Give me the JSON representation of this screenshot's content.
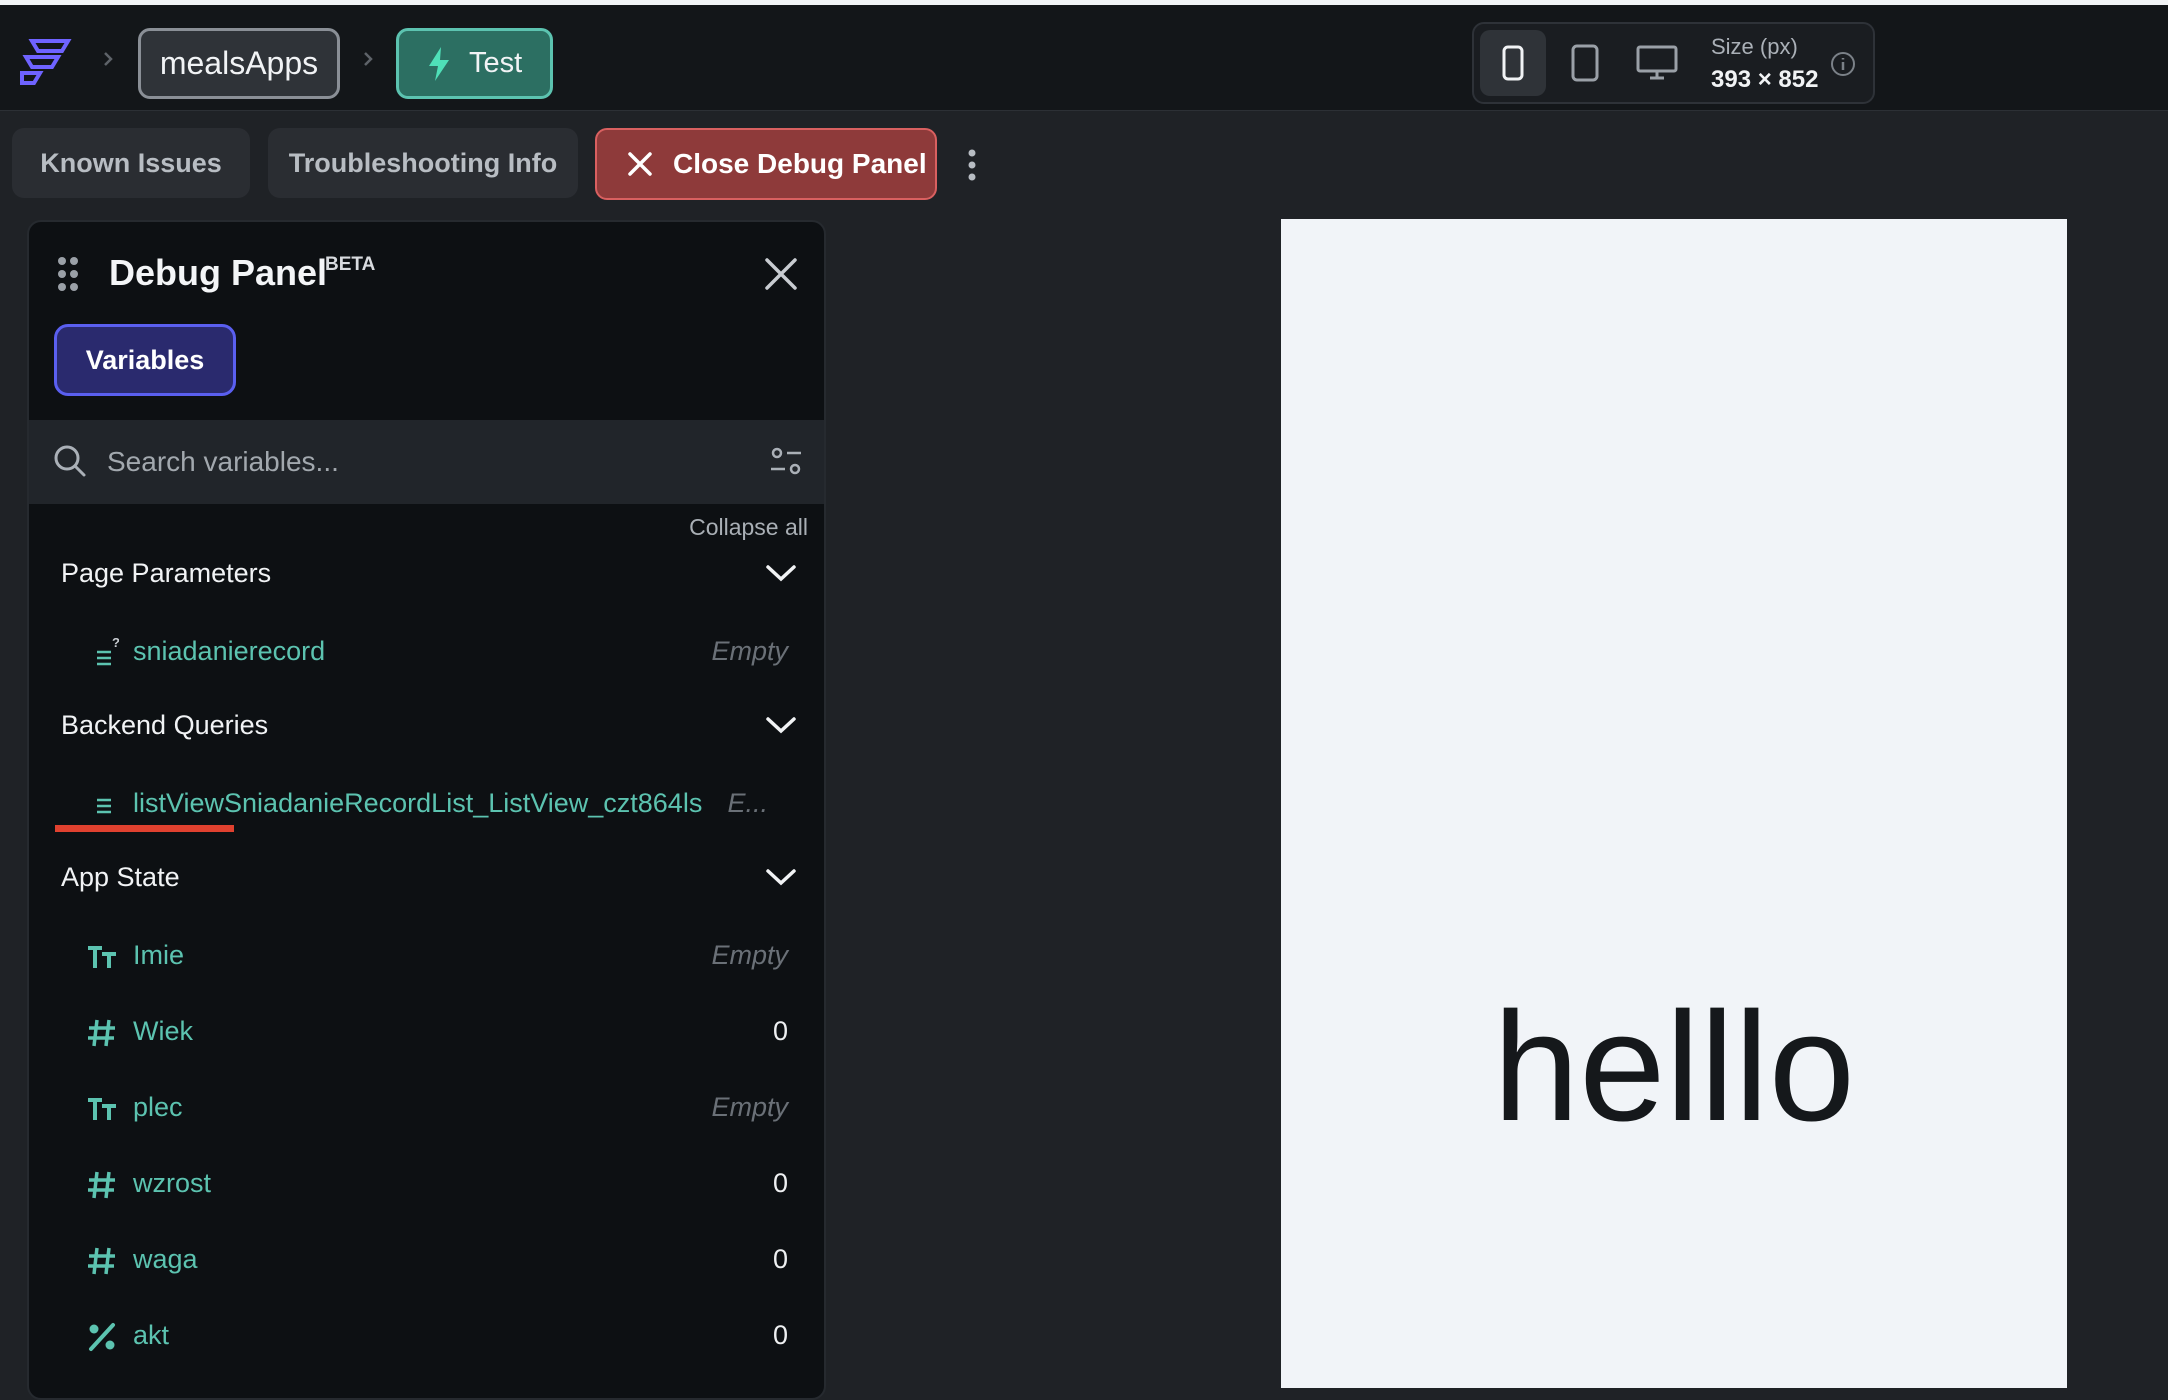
{
  "breadcrumb": {
    "project": "mealsApps",
    "mode": "Test"
  },
  "device": {
    "size_label": "Size (px)",
    "size_value": "393 × 852",
    "active": "phone"
  },
  "toolbar": {
    "known_issues": "Known Issues",
    "troubleshooting": "Troubleshooting Info",
    "close_debug": "Close Debug Panel"
  },
  "debug_panel": {
    "title": "Debug Panel",
    "badge": "BETA",
    "tab": "Variables",
    "search_placeholder": "Search variables...",
    "collapse_all": "Collapse all",
    "sections": [
      {
        "title": "Page Parameters",
        "items": [
          {
            "icon": "list-optional-icon",
            "name": "sniadanierecord",
            "value": "Empty"
          }
        ]
      },
      {
        "title": "Backend Queries",
        "items": [
          {
            "icon": "list-icon",
            "name": "listViewSniadanieRecordList_ListView_czt864ls",
            "value": "E..."
          }
        ]
      },
      {
        "title": "App State",
        "items": [
          {
            "icon": "text-icon",
            "name": "Imie",
            "value": "Empty"
          },
          {
            "icon": "number-icon",
            "name": "Wiek",
            "value": "0"
          },
          {
            "icon": "text-icon",
            "name": "plec",
            "value": "Empty"
          },
          {
            "icon": "number-icon",
            "name": "wzrost",
            "value": "0"
          },
          {
            "icon": "number-icon",
            "name": "waga",
            "value": "0"
          },
          {
            "icon": "percent-icon",
            "name": "akt",
            "value": "0"
          }
        ]
      }
    ]
  },
  "canvas": {
    "text": "helllo"
  },
  "colors": {
    "accent": "#5cc3b0",
    "danger": "#8e3a3a",
    "variables_tab": "#2a2a6e",
    "underline": "#e0412f"
  }
}
